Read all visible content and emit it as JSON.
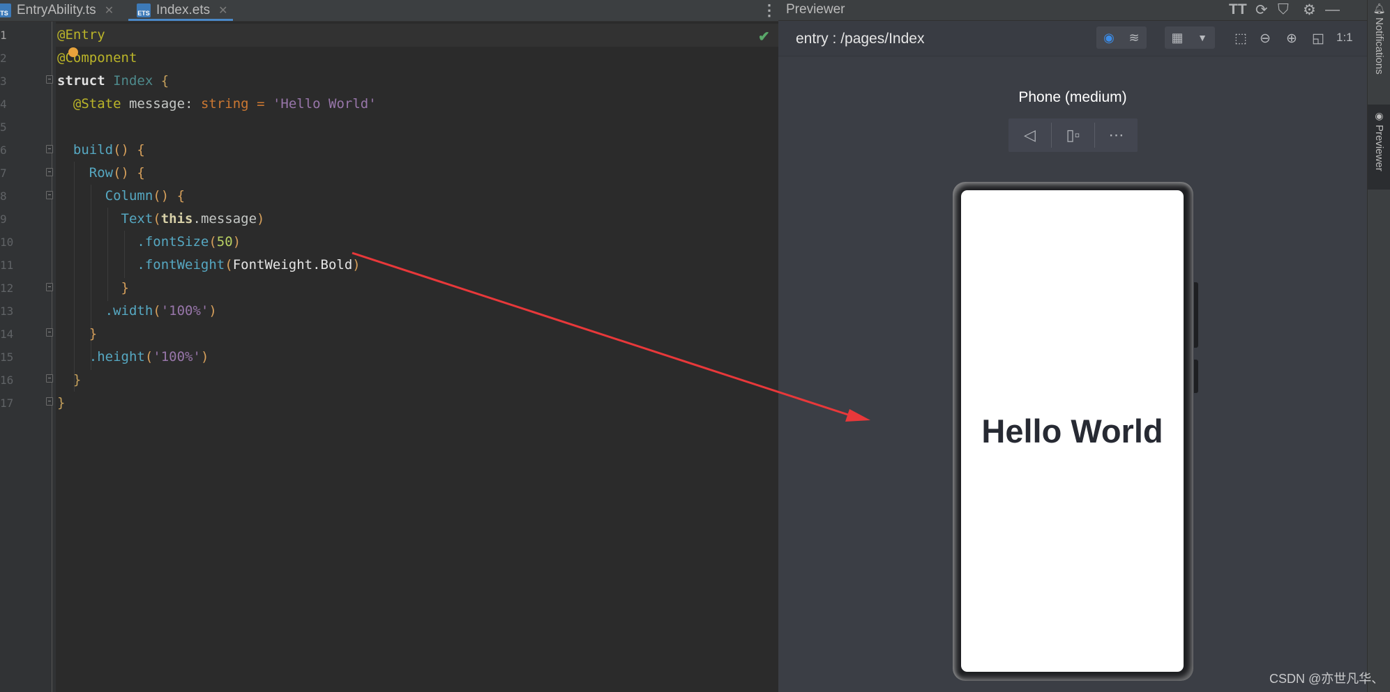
{
  "editor": {
    "tabs": [
      {
        "label": "EntryAbility.ts",
        "icon": "ts-file-icon",
        "badge": "TS",
        "active": false
      },
      {
        "label": "Index.ets",
        "icon": "ets-file-icon",
        "badge": "ETS",
        "active": true
      }
    ],
    "line_numbers": [
      "1",
      "2",
      "3",
      "4",
      "5",
      "6",
      "7",
      "8",
      "9",
      "10",
      "11",
      "12",
      "13",
      "14",
      "15",
      "16",
      "17"
    ],
    "current_line": 1,
    "code": {
      "l1": "@Entry",
      "l2_a": "@",
      "l2_b": "Component",
      "l3_kw": "struct",
      "l3_name": "Index",
      "l3_br": "{",
      "l4_ann": "@State",
      "l4_var": "message",
      "l4_colon": ":",
      "l4_type": "string",
      "l4_eq": "=",
      "l4_str": "'Hello World'",
      "l6_fn": "build",
      "l6_rest": "() {",
      "l7_fn": "Row",
      "l7_rest": "() {",
      "l8_fn": "Column",
      "l8_rest": "() {",
      "l9_fn": "Text",
      "l9_open": "(",
      "l9_this": "this",
      "l9_field": ".message",
      "l9_close": ")",
      "l10_fn": ".fontSize",
      "l10_open": "(",
      "l10_num": "50",
      "l10_close": ")",
      "l11_fn": ".fontWeight",
      "l11_open": "(",
      "l11_arg": "FontWeight.Bold",
      "l11_close": ")",
      "l12": "}",
      "l13_fn": ".width",
      "l13_open": "(",
      "l13_str": "'100%'",
      "l13_close": ")",
      "l14": "}",
      "l15_fn": ".height",
      "l15_open": "(",
      "l15_str": "'100%'",
      "l15_close": ")",
      "l16": "}",
      "l17": "}"
    }
  },
  "previewer": {
    "title": "Previewer",
    "page_path": "entry : /pages/Index",
    "toolbar_zoom_reset": "1:1",
    "device_label": "Phone (medium)",
    "screen_text": "Hello World"
  },
  "right_strip": {
    "notifications": "Notifications",
    "previewer": "Previewer"
  },
  "watermark": "CSDN @亦世凡华、",
  "colors": {
    "arrow": "#e8383a",
    "accent": "#3c8ce7",
    "bookmark": "#e8a33c"
  }
}
